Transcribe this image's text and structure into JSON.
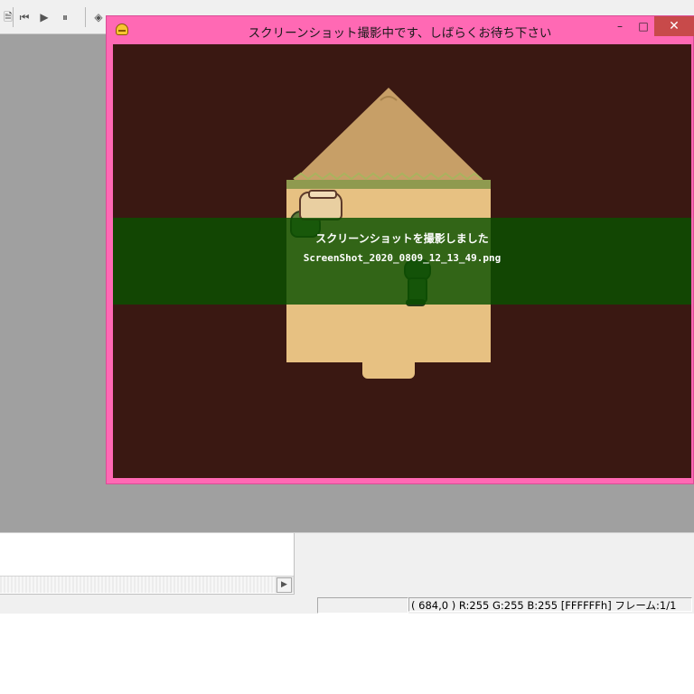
{
  "game_window": {
    "title": "スクリーンショット撮影中です、しばらくお待ち下さい",
    "controls": {
      "minimize": "–",
      "maximize": "□",
      "close": "✕"
    }
  },
  "notification": {
    "message": "スクリーンショットを撮影しました",
    "filename": "ScreenShot_2020_0809_12_13_49.png"
  },
  "status_bar": {
    "info": "( 684,0 ) R:255 G:255 B:255  [FFFFFFh]  フレーム:1/1"
  },
  "toolbar": {
    "icons": [
      "document-icon",
      "rewind-icon",
      "play-icon",
      "pause-icon",
      "paint-icon"
    ]
  },
  "colors": {
    "window_frame": "#ff69b4",
    "game_background": "#3a1812",
    "roof": "#c79f67",
    "house_wall": "#e7c182",
    "notification_band": "#0a5000"
  }
}
